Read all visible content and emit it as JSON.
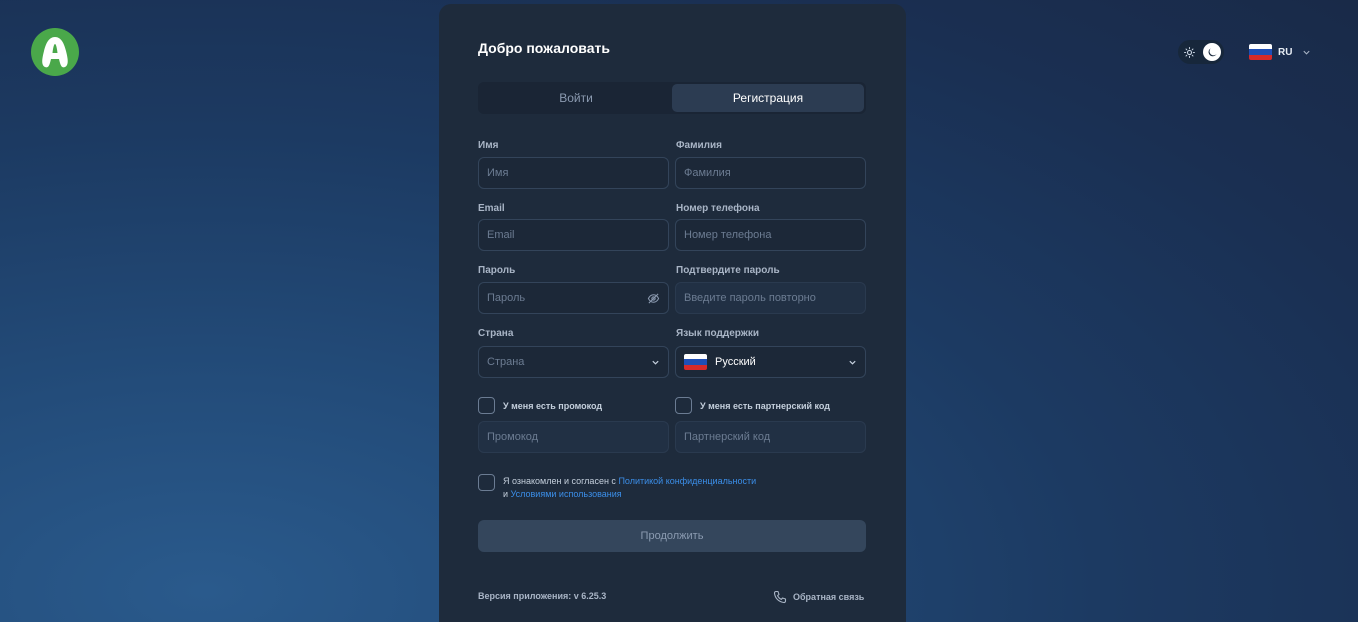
{
  "header": {
    "logo_icon": "app-logo",
    "language_code": "RU",
    "theme": "dark"
  },
  "form": {
    "title": "Добро пожаловать",
    "tabs": [
      {
        "label": "Войти",
        "active": false
      },
      {
        "label": "Регистрация",
        "active": true
      }
    ],
    "first_name": {
      "label": "Имя",
      "placeholder": "Имя"
    },
    "last_name": {
      "label": "Фамилия",
      "placeholder": "Фамилия"
    },
    "email": {
      "label": "Email",
      "placeholder": "Email"
    },
    "phone": {
      "label": "Номер телефона",
      "placeholder": "Номер телефона"
    },
    "password": {
      "label": "Пароль",
      "placeholder": "Пароль"
    },
    "confirm_password": {
      "label": "Подтвердите пароль",
      "placeholder": "Введите пароль повторно"
    },
    "country": {
      "label": "Страна",
      "placeholder": "Страна"
    },
    "support_language": {
      "label": "Язык поддержки",
      "value": "Русский"
    },
    "promo_checkbox_label": "У меня есть промокод",
    "promo_placeholder": "Промокод",
    "partner_checkbox_label": "У меня есть партнерский код",
    "partner_placeholder": "Партнерский код",
    "consent": {
      "prefix": "Я ознакомлен и согласен с",
      "privacy_link": "Политикой конфиденциальности",
      "and": "и",
      "terms_link": "Условиями использования"
    },
    "continue_label": "Продолжить"
  },
  "footer": {
    "version": "Версия приложения: v 6.25.3",
    "feedback": "Обратная связь"
  },
  "colors": {
    "accent_link": "#3b8ee8",
    "logo_green": "#4aa84a",
    "card_bg": "#1e2b3c"
  }
}
